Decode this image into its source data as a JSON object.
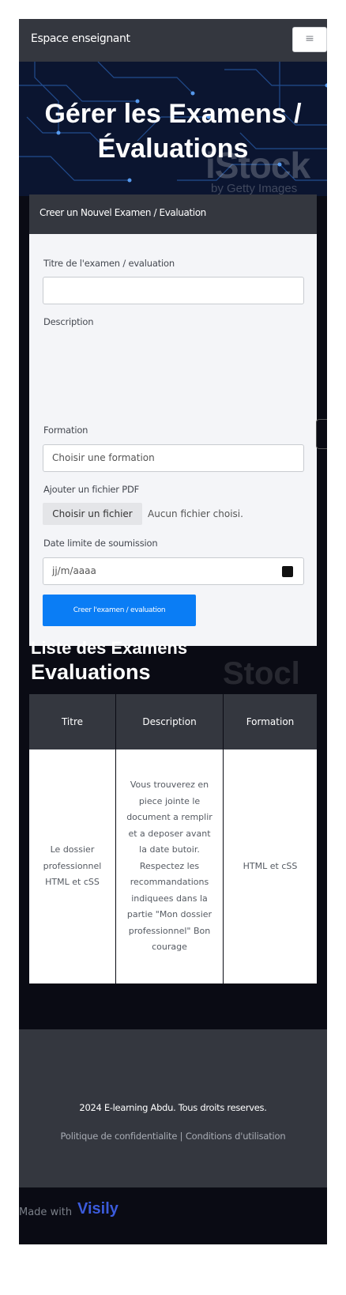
{
  "navbar": {
    "brand": "Espace enseignant",
    "menu_icon": "hamburger-icon",
    "menu_glyph": "≡"
  },
  "hero": {
    "title": "Gérer les Examens / Évaluations",
    "watermark_main": "iStock",
    "watermark_sub": "by Getty Images"
  },
  "form": {
    "header": "Creer un Nouvel Examen / Evaluation",
    "title_label": "Titre de l'examen / evaluation",
    "title_value": "",
    "description_label": "Description",
    "formation_label": "Formation",
    "formation_placeholder": "Choisir une formation",
    "pdf_label": "Ajouter un fichier PDF",
    "file_button": "Choisir un fichier",
    "file_status": "Aucun fichier choisi.",
    "deadline_label": "Date limite de soumission",
    "deadline_placeholder": "jj/m/aaaa",
    "calendar_icon": "calendar-icon",
    "submit_label": "Creer l'examen / evaluation"
  },
  "list": {
    "title_line1": "Liste des Examens",
    "title_line2": "Evaluations",
    "watermark": "Stocl",
    "columns": [
      "Titre",
      "Description",
      "Formation"
    ],
    "rows": [
      {
        "titre": "Le dossier professionnel HTML et cSS",
        "description": "Vous trouverez en piece jointe le document a remplir et a deposer avant la date butoir. Respectez les recommandations indiquees dans la partie \"Mon dossier professionnel\" Bon courage",
        "formation": "HTML et cSS"
      }
    ]
  },
  "footer": {
    "copyright": "2024 E-learning Abdu. Tous droits reserves.",
    "links": "Politique de confidentialite | Conditions d'utilisation"
  },
  "badge": {
    "made_with": "Made with",
    "brand": "Visily"
  },
  "colors": {
    "accent": "#0a7df5",
    "panel": "#34373f",
    "background": "#0a0b14"
  }
}
